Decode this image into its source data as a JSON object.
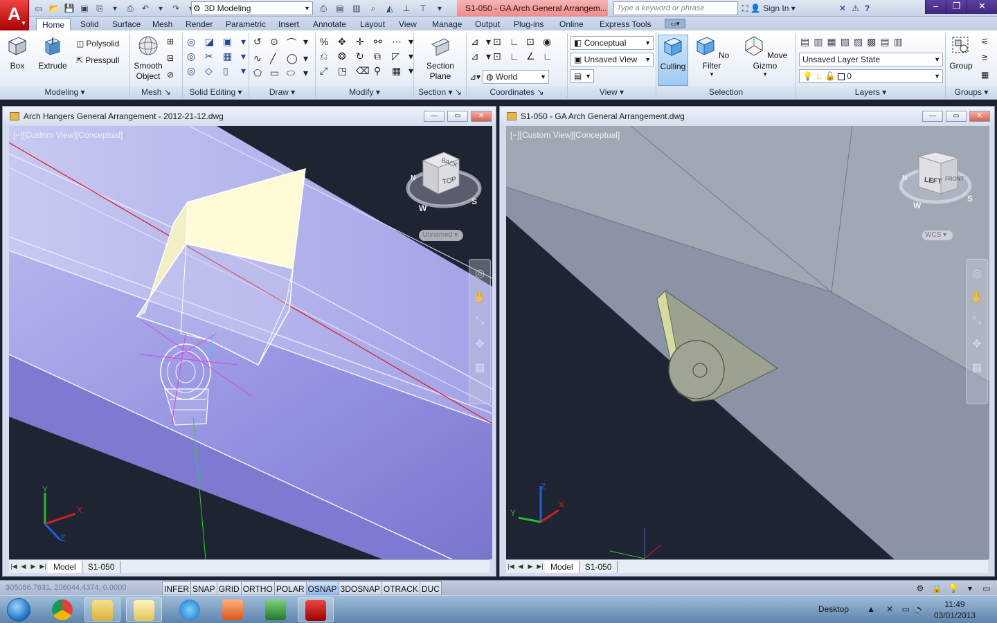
{
  "app": {
    "logo_letter": "A",
    "workspace": "3D Modeling",
    "doc_title": "S1-050 - GA Arch General Arrangem...",
    "search_placeholder": "Type a keyword or phrase",
    "sign_in": "Sign In"
  },
  "ribbon_tabs": [
    "Home",
    "Solid",
    "Surface",
    "Mesh",
    "Render",
    "Parametric",
    "Insert",
    "Annotate",
    "Layout",
    "View",
    "Manage",
    "Output",
    "Plug-ins",
    "Online",
    "Express Tools"
  ],
  "active_tab": "Home",
  "panels": {
    "modeling": {
      "title": "Modeling",
      "box": "Box",
      "extrude": "Extrude",
      "polysolid": "Polysolid",
      "presspull": "Presspull"
    },
    "mesh": {
      "title": "Mesh",
      "smooth_object_1": "Smooth",
      "smooth_object_2": "Object"
    },
    "solid_editing": {
      "title": "Solid Editing"
    },
    "draw": {
      "title": "Draw"
    },
    "modify": {
      "title": "Modify"
    },
    "section": {
      "title": "Section",
      "section_plane_1": "Section",
      "section_plane_2": "Plane"
    },
    "coordinates": {
      "title": "Coordinates",
      "world": "World"
    },
    "view": {
      "title": "View",
      "visual_style": "Conceptual",
      "named_view": "Unsaved View"
    },
    "selection": {
      "title": "Selection",
      "culling": "Culling",
      "no_filter": "No Filter",
      "move_gizmo": "Move Gizmo"
    },
    "layers": {
      "title": "Layers",
      "layer_state": "Unsaved Layer State",
      "current_layer": "0"
    },
    "groups": {
      "title": "Groups",
      "group": "Group"
    }
  },
  "viewports": {
    "left": {
      "title": "Arch Hangers General Arrangement - 2012-21-12.dwg",
      "label": "[−][Custom View][Conceptual]",
      "viewcube_face": "TOP",
      "viewcube_face2": "BACK",
      "compass": [
        "N",
        "W",
        "S"
      ],
      "ucs_menu": "Unnamed",
      "layout_tabs": [
        "Model",
        "S1-050"
      ],
      "axis": {
        "x": "X",
        "y": "Y",
        "z": "Z"
      }
    },
    "right": {
      "title": "S1-050 - GA Arch General Arrangement.dwg",
      "label": "[−][Custom View][Conceptual]",
      "viewcube_face": "LEFT",
      "viewcube_face2": "FRONT",
      "compass": [
        "N",
        "W",
        "S"
      ],
      "ucs_menu": "WCS",
      "layout_tabs": [
        "Model",
        "S1-050"
      ],
      "axis": {
        "x": "X",
        "y": "Y",
        "z": "Z"
      }
    }
  },
  "status": {
    "coords": "305086.7631, 206044.4374, 0.0000",
    "toggles": [
      "INFER",
      "SNAP",
      "GRID",
      "ORTHO",
      "POLAR",
      "OSNAP",
      "3DOSNAP",
      "OTRACK",
      "DUC"
    ],
    "active_toggles": [
      "OSNAP"
    ]
  },
  "taskbar": {
    "desktop": "Desktop",
    "time": "11:49",
    "date": "03/01/2013"
  },
  "colors": {
    "beam_left": "#8f8ee0",
    "beam_right": "#8a96a8",
    "canvas_bg": "#1f2433",
    "red_line": "#e0202a"
  }
}
